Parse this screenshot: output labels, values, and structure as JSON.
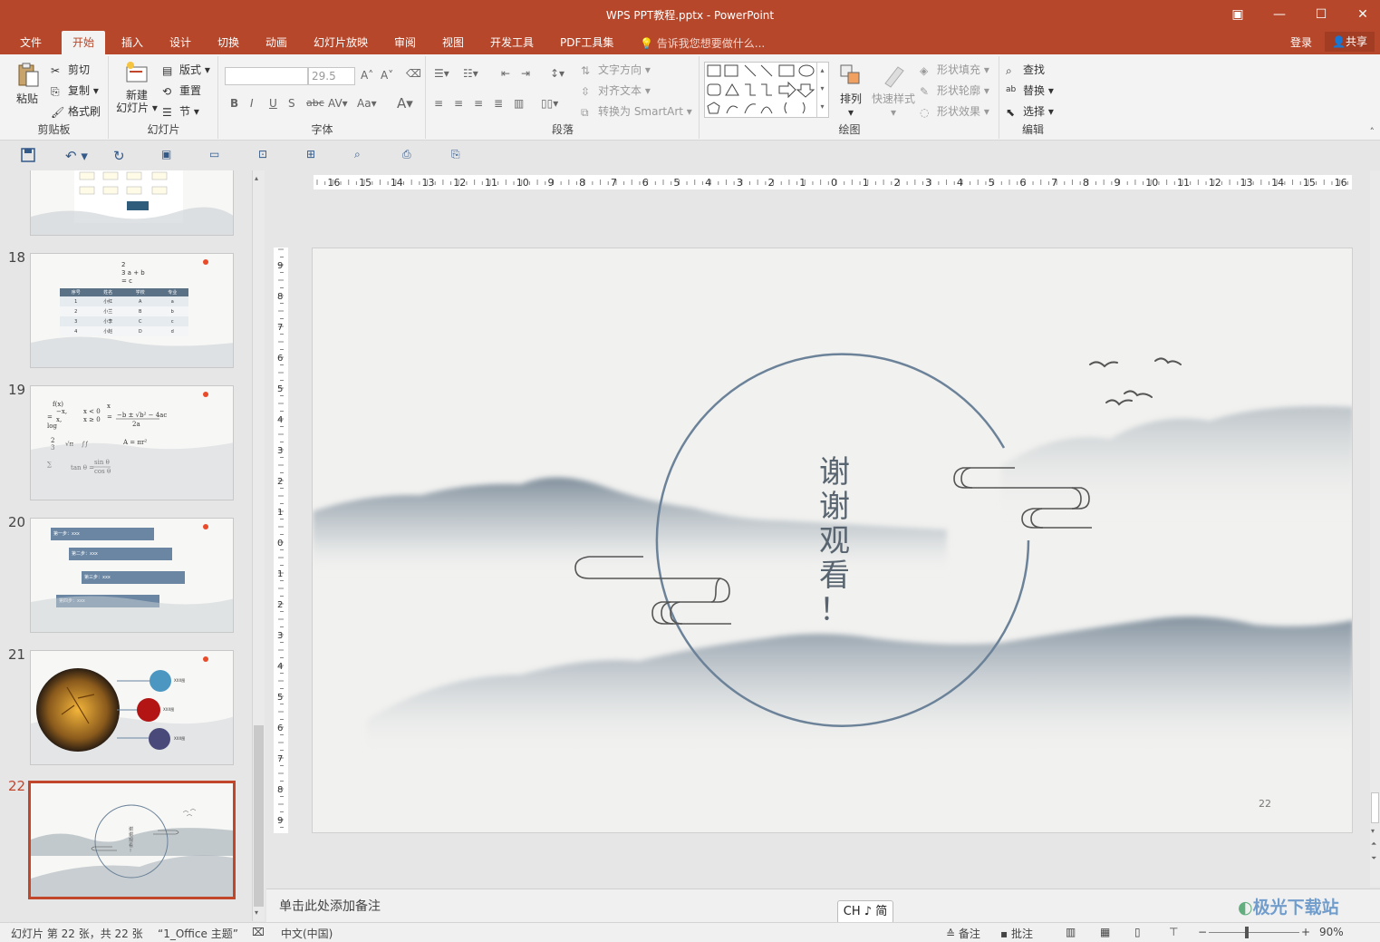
{
  "window": {
    "title": "WPS PPT教程.pptx - PowerPoint"
  },
  "menu": {
    "tabs": [
      "文件",
      "开始",
      "插入",
      "设计",
      "切换",
      "动画",
      "幻灯片放映",
      "审阅",
      "视图",
      "开发工具",
      "PDF工具集"
    ],
    "active_tab": "开始",
    "tell_me": "告诉我您想要做什么...",
    "login": "登录",
    "share": "共享"
  },
  "ribbon": {
    "clipboard": {
      "label": "剪贴板",
      "paste": "粘贴",
      "cut": "剪切",
      "copy": "复制",
      "format_painter": "格式刷"
    },
    "slides": {
      "label": "幻灯片",
      "new_slide_1": "新建",
      "new_slide_2": "幻灯片",
      "layout": "版式",
      "reset": "重置",
      "section": "节"
    },
    "font": {
      "label": "字体",
      "font_size": "29.5",
      "font_name": ""
    },
    "paragraph": {
      "label": "段落",
      "text_direction": "文字方向",
      "align_text": "对齐文本",
      "smartart": "转换为 SmartArt"
    },
    "drawing": {
      "label": "绘图",
      "arrange": "排列",
      "quick_styles": "快速样式",
      "shape_fill": "形状填充",
      "shape_outline": "形状轮廓",
      "shape_effects": "形状效果"
    },
    "editing": {
      "label": "编辑",
      "find": "查找",
      "replace": "替换",
      "select": "选择"
    }
  },
  "thumbnails": [
    {
      "number": "18",
      "table_headers": [
        "序号",
        "姓名",
        "学校",
        "专业"
      ],
      "rows": [
        [
          "1",
          "小红",
          "A",
          "a"
        ],
        [
          "2",
          "小兰",
          "B",
          "b"
        ],
        [
          "3",
          "小李",
          "C",
          "c"
        ],
        [
          "4",
          "小赵",
          "D",
          "d"
        ]
      ]
    },
    {
      "number": "19"
    },
    {
      "number": "20",
      "steps": [
        "第一步：xxx",
        "第二步：xxx",
        "第三步：xxx",
        "第四步：xxx"
      ]
    },
    {
      "number": "21",
      "labels": [
        "XXX图",
        "XXX图",
        "XXX图"
      ]
    },
    {
      "number": "22",
      "active": true
    }
  ],
  "slide": {
    "title_chars": [
      "谢",
      "谢",
      "观",
      "看",
      "！"
    ],
    "page_number": "22"
  },
  "hruler_labels": [
    "16",
    "15",
    "14",
    "13",
    "12",
    "11",
    "10",
    "9",
    "8",
    "7",
    "6",
    "5",
    "4",
    "3",
    "2",
    "1",
    "0",
    "1",
    "2",
    "3",
    "4",
    "5",
    "6",
    "7",
    "8",
    "9",
    "10",
    "11",
    "12",
    "13",
    "14",
    "15",
    "16"
  ],
  "vruler_labels": [
    "9",
    "8",
    "7",
    "6",
    "5",
    "4",
    "3",
    "2",
    "1",
    "0",
    "1",
    "2",
    "3",
    "4",
    "5",
    "6",
    "7",
    "8",
    "9"
  ],
  "notes": {
    "placeholder": "单击此处添加备注"
  },
  "ime": {
    "text": "CH ♪ 简"
  },
  "status": {
    "slide_info": "幻灯片 第 22 张，共 22 张",
    "theme": "“1_Office 主题”",
    "language": "中文(中国)",
    "notes": "备注",
    "comments": "批注",
    "zoom": "90%"
  },
  "watermark": "极光下载站"
}
